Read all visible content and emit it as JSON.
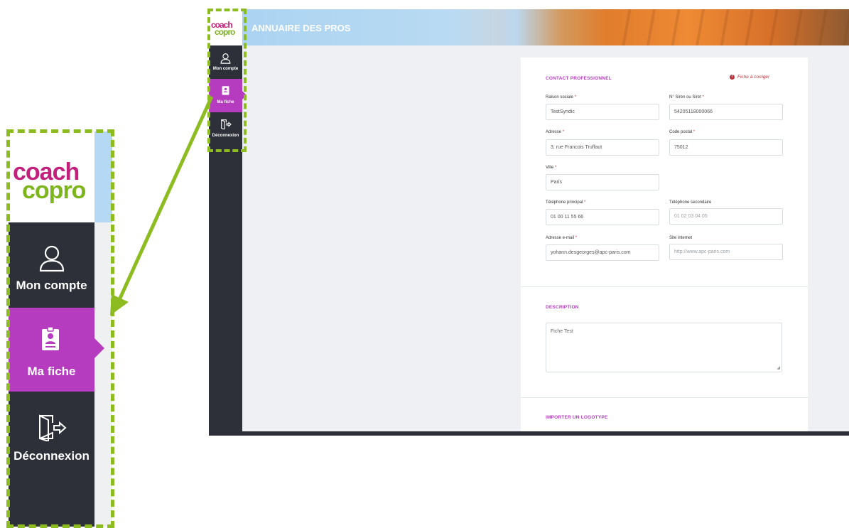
{
  "brand": {
    "logo_line1": "coach",
    "logo_line2": "copro"
  },
  "sidebar": {
    "items": [
      {
        "label": "Mon compte",
        "icon": "user-icon"
      },
      {
        "label": "Ma fiche",
        "icon": "badge-icon",
        "active": true
      },
      {
        "label": "Déconnexion",
        "icon": "logout-door-icon"
      }
    ]
  },
  "header": {
    "title": "ANNUAIRE DES PROS"
  },
  "form": {
    "contact_section": "CONTACT PROFESSIONNEL",
    "status_text": "Fiche à corriger",
    "required_mark": "*",
    "fields": {
      "raison_sociale": {
        "label": "Raison sociale",
        "value": "TestSyndic"
      },
      "siren": {
        "label": "N° Siren ou Siret",
        "value": "54205118000066"
      },
      "adresse": {
        "label": "Adresse",
        "value": "3, rue Francois Truffaut"
      },
      "code_postal": {
        "label": "Code postal",
        "value": "75012"
      },
      "ville": {
        "label": "Ville",
        "value": "Paris"
      },
      "tel_principal": {
        "label": "Téléphone principal",
        "value": "01 00 11 55 66"
      },
      "tel_secondaire": {
        "label": "Téléphone secondaire",
        "placeholder": "01 02 03 04 05"
      },
      "email": {
        "label": "Adresse e-mail",
        "value": "yohann.desgeorges@apc-paris.com"
      },
      "site": {
        "label": "Site internet",
        "placeholder": "http://www.apc-paris.com"
      }
    },
    "description_section": "DESCRIPTION",
    "description_value": "Fiche Test",
    "logo_section": "IMPORTER UN LOGOTYPE"
  },
  "colors": {
    "accent": "#b53bbf",
    "sidebar": "#2d3038",
    "highlight": "#8cbc1f",
    "error": "#c0303a",
    "logo_pink": "#c2207b",
    "logo_green": "#7db51d"
  }
}
